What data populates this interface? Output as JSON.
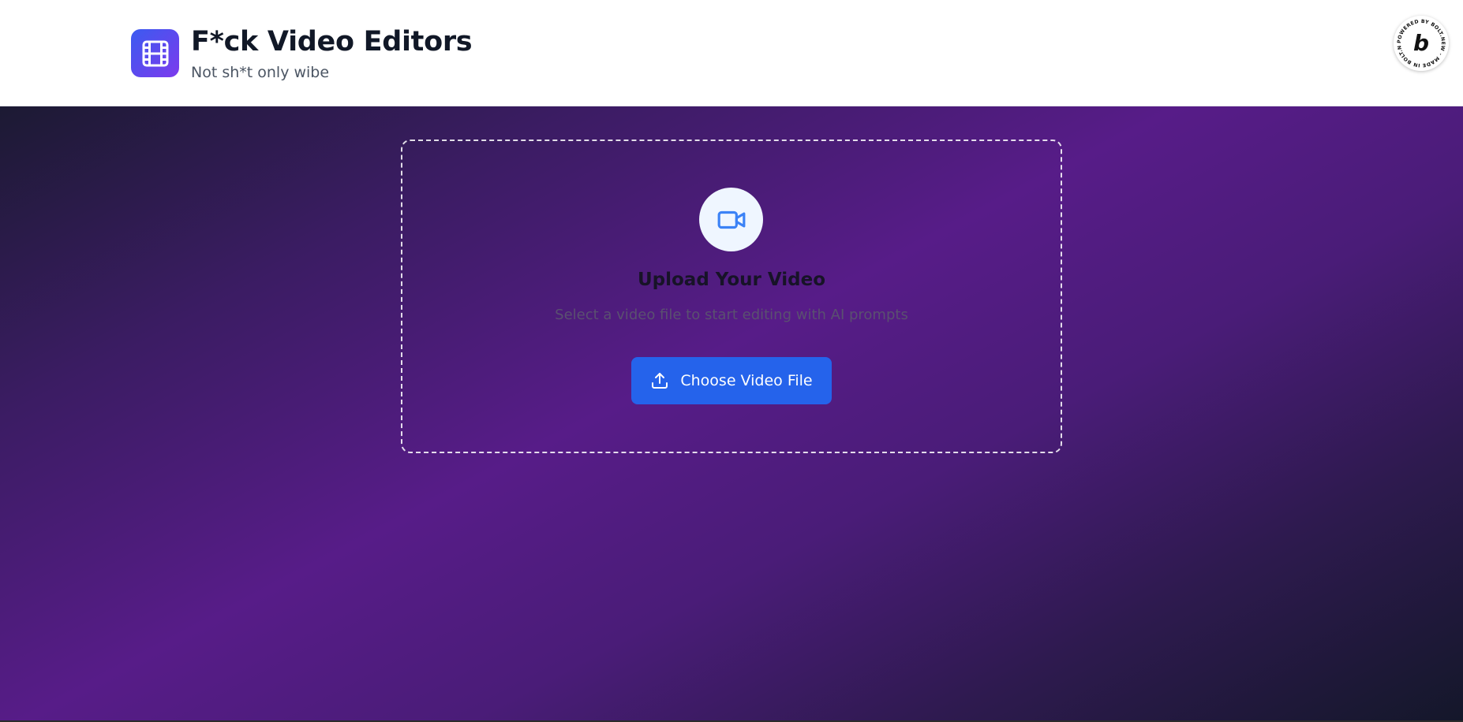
{
  "header": {
    "title": "F*ck Video Editors",
    "subtitle": "Not sh*t only wibe",
    "logo_icon": "film-icon",
    "badge": {
      "ring_text": "POWERED BY BOLT.NEW · MADE IN BOLT.NEW · ",
      "letter": "b"
    }
  },
  "upload": {
    "icon": "video-camera-icon",
    "title": "Upload Your Video",
    "description": "Select a video file to start editing with AI prompts",
    "button_label": "Choose Video File",
    "button_icon": "upload-icon"
  },
  "colors": {
    "accent": "#2563eb",
    "logo_gradient_start": "#3b5bf0",
    "logo_gradient_end": "#7c3aed",
    "background_purple": "#571c88",
    "background_dark": "#14172a"
  }
}
